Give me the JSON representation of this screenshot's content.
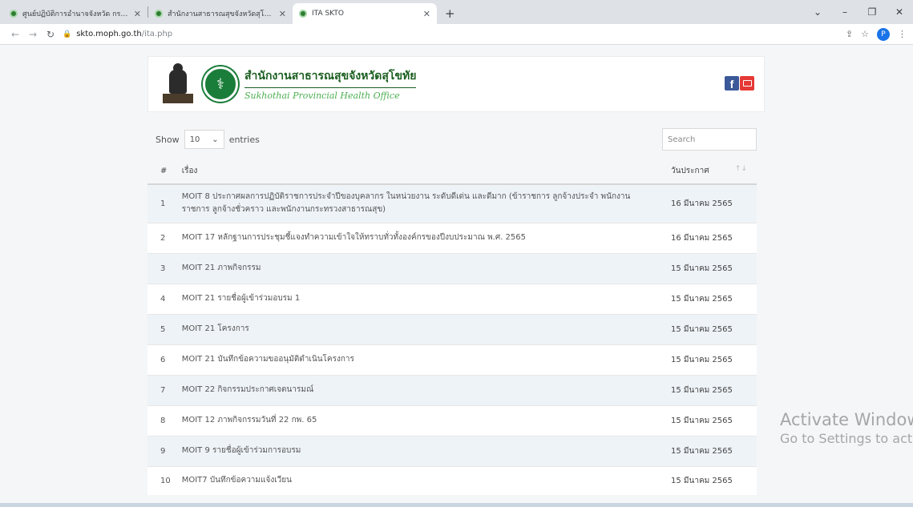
{
  "browser": {
    "tabs": [
      {
        "title": "ศูนย์ปฏิบัติการอำนาจจังหวัด กระทรวงสาธารณสุข",
        "active": false
      },
      {
        "title": "สำนักงานสาธารณสุขจังหวัดสุโขทัย",
        "active": false
      },
      {
        "title": "ITA SKTO",
        "active": true
      }
    ],
    "new_tab": "+",
    "url_host": "skto.moph.go.th",
    "url_path": "/ita.php",
    "profile_initial": "P"
  },
  "header": {
    "org_name_th": "สำนักงานสาธารณสุขจังหวัดสุโขทัย",
    "org_name_en": "Sukhothai Provincial Health Office",
    "fb_letter": "f"
  },
  "controls": {
    "show_label": "Show",
    "page_length": "10",
    "entries_label": "entries",
    "search_placeholder": "Search"
  },
  "table": {
    "columns": {
      "num": "#",
      "title": "เรื่อง",
      "date": "วันประกาศ"
    },
    "rows": [
      {
        "num": "1",
        "title": "MOIT 8 ประกาศผลการปฏิบัติราชการประจำปีของบุคลากร ในหน่วยงาน ระดับดีเด่น และดีมาก (ข้าราชการ ลูกจ้างประจำ พนักงานราชการ ลูกจ้างชั่วคราว และพนักงานกระทรวงสาธารณสุข)",
        "date": "16 มีนาคม 2565"
      },
      {
        "num": "2",
        "title": "MOIT 17 หลักฐานการประชุมชี้แจงทำความเข้าใจให้ทราบทั่วทั้งองค์กรของปีงบประมาณ พ.ศ. 2565",
        "date": "16 มีนาคม 2565"
      },
      {
        "num": "3",
        "title": "MOIT 21 ภาพกิจกรรม",
        "date": "15 มีนาคม 2565"
      },
      {
        "num": "4",
        "title": "MOIT 21 รายชื่อผู้เข้าร่วมอบรม 1",
        "date": "15 มีนาคม 2565"
      },
      {
        "num": "5",
        "title": "MOIT 21 โครงการ",
        "date": "15 มีนาคม 2565"
      },
      {
        "num": "6",
        "title": "MOIT 21 บันทึกข้อความขออนุมัติดำเนินโครงการ",
        "date": "15 มีนาคม 2565"
      },
      {
        "num": "7",
        "title": "MOIT 22 กิจกรรมประกาศเจตนารมณ์",
        "date": "15 มีนาคม 2565"
      },
      {
        "num": "8",
        "title": "MOIT 12 ภาพกิจกรรมวันที่ 22 กพ. 65",
        "date": "15 มีนาคม 2565"
      },
      {
        "num": "9",
        "title": "MOIT 9 รายชื่อผู้เข้าร่วมการอบรม",
        "date": "15 มีนาคม 2565"
      },
      {
        "num": "10",
        "title": "MOIT7 บันทึกข้อความแจ้งเวียน",
        "date": "15 มีนาคม 2565"
      }
    ]
  },
  "watermark": {
    "line1": "Activate Windows",
    "line2": "Go to Settings to activate Windows."
  }
}
